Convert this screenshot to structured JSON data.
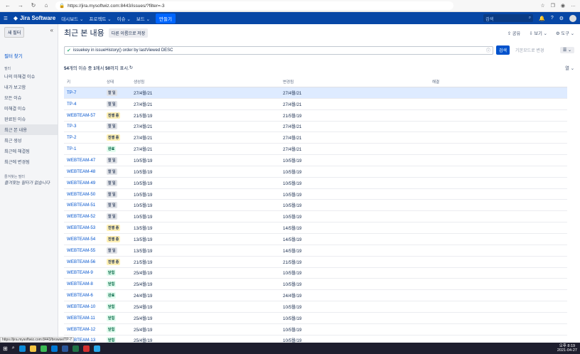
{
  "browser": {
    "url": "https://jira.mysoftwiz.com:8443/issues/?filter=-3"
  },
  "nav": {
    "logo": "Jira Software",
    "items": [
      "대시보드 ⌄",
      "프로젝트 ⌄",
      "이슈 ⌄",
      "보드 ⌄"
    ],
    "create": "만들기",
    "search_placeholder": "검색"
  },
  "sidebar": {
    "new_filter": "새 필터",
    "find_filters": "필터 찾기",
    "filters_label": "필터",
    "items": [
      "나의 미해결 이슈",
      "내가 보고함",
      "모든 이슈",
      "미해결 이슈",
      "완료된 이슈",
      "최근 본 내용",
      "최근 생성",
      "최근에 해결됨",
      "최근에 변경됨"
    ],
    "favorites_label": "즐겨찾는 필터",
    "favorites_empty": "즐겨찾는 필터가 없습니다"
  },
  "main": {
    "title": "최근 본 내용",
    "save_as": "다른 이름으로 저장",
    "share": "공유",
    "view": "보기 ⌄",
    "tools": "도구 ⌄",
    "jql": "issuekey in issueHistory() order by lastViewed DESC",
    "search": "검색",
    "basic": "기본모드로 변경",
    "summary_total": "54",
    "summary_text_1": "개의 이슈 중 ",
    "summary_from": "1",
    "summary_text_2": "에서 ",
    "summary_to": "50",
    "summary_text_3": "까지 표시.",
    "columns": [
      "키",
      "상태",
      "생성됨",
      "변경됨",
      "해결"
    ]
  },
  "status_bar_url": "https://jira.mysoftwiz.com:8443/browse/TP-7",
  "taskbar_time": [
    "오후 8:19",
    "2021-04-27"
  ],
  "status_colors": {
    "할 일": [
      "#dfe1e6",
      "#42526e"
    ],
    "진행 중": [
      "#fff0b3",
      "#172b4d"
    ],
    "완료": [
      "#e3fcef",
      "#006644"
    ],
    "닫힘": [
      "#e3fcef",
      "#006644"
    ]
  },
  "rows": [
    {
      "key": "TP-7",
      "status": "할 일",
      "created": "27/4월/21",
      "updated": "27/4월/21"
    },
    {
      "key": "TP-4",
      "status": "할 일",
      "created": "27/4월/21",
      "updated": "27/4월/21"
    },
    {
      "key": "WEBTEAM-57",
      "status": "진행 중",
      "created": "21/5월/19",
      "updated": "21/5월/19"
    },
    {
      "key": "TP-3",
      "status": "할 일",
      "created": "27/4월/21",
      "updated": "27/4월/21"
    },
    {
      "key": "TP-2",
      "status": "진행 중",
      "created": "27/4월/21",
      "updated": "27/4월/21"
    },
    {
      "key": "TP-1",
      "status": "완료",
      "created": "27/4월/21",
      "updated": "27/4월/21"
    },
    {
      "key": "WEBTEAM-47",
      "status": "할 일",
      "created": "10/5월/19",
      "updated": "10/5월/19"
    },
    {
      "key": "WEBTEAM-48",
      "status": "할 일",
      "created": "10/5월/19",
      "updated": "10/5월/19"
    },
    {
      "key": "WEBTEAM-49",
      "status": "할 일",
      "created": "10/5월/19",
      "updated": "10/5월/19"
    },
    {
      "key": "WEBTEAM-50",
      "status": "할 일",
      "created": "10/5월/19",
      "updated": "10/5월/19"
    },
    {
      "key": "WEBTEAM-51",
      "status": "할 일",
      "created": "10/5월/19",
      "updated": "10/5월/19"
    },
    {
      "key": "WEBTEAM-52",
      "status": "할 일",
      "created": "10/5월/19",
      "updated": "10/5월/19"
    },
    {
      "key": "WEBTEAM-53",
      "status": "진행 중",
      "created": "13/5월/19",
      "updated": "14/5월/19"
    },
    {
      "key": "WEBTEAM-54",
      "status": "진행 중",
      "created": "13/5월/19",
      "updated": "14/5월/19"
    },
    {
      "key": "WEBTEAM-55",
      "status": "할 일",
      "created": "13/5월/19",
      "updated": "14/5월/19"
    },
    {
      "key": "WEBTEAM-56",
      "status": "진행 중",
      "created": "21/5월/19",
      "updated": "21/5월/19"
    },
    {
      "key": "WEBTEAM-9",
      "status": "닫힘",
      "created": "25/4월/19",
      "updated": "10/5월/19"
    },
    {
      "key": "WEBTEAM-8",
      "status": "닫힘",
      "created": "25/4월/19",
      "updated": "10/5월/19"
    },
    {
      "key": "WEBTEAM-6",
      "status": "완료",
      "created": "24/4월/19",
      "updated": "24/4월/19"
    },
    {
      "key": "WEBTEAM-10",
      "status": "닫힘",
      "created": "25/4월/19",
      "updated": "10/5월/19"
    },
    {
      "key": "WEBTEAM-11",
      "status": "닫힘",
      "created": "25/4월/19",
      "updated": "10/5월/19"
    },
    {
      "key": "WEBTEAM-12",
      "status": "닫힘",
      "created": "25/4월/19",
      "updated": "10/5월/19"
    },
    {
      "key": "WEBTEAM-13",
      "status": "닫힘",
      "created": "25/4월/19",
      "updated": "10/5월/19"
    }
  ]
}
